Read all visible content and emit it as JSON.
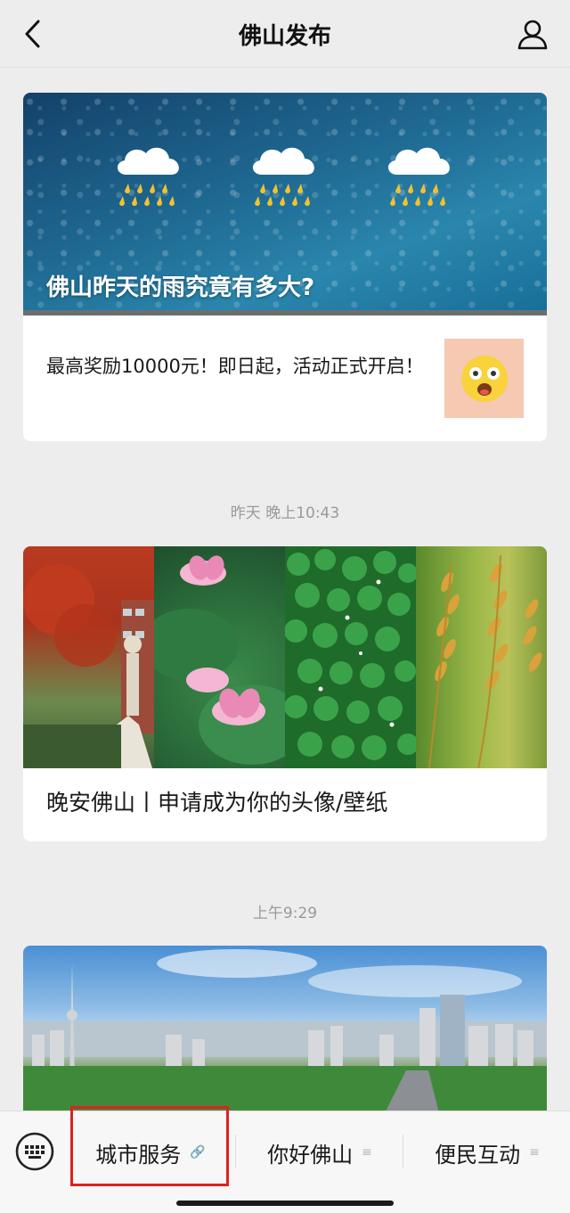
{
  "header": {
    "title": "佛山发布",
    "back_icon": "chevron-left-icon",
    "profile_icon": "person-icon"
  },
  "articles": [
    {
      "image": "rain-clouds-banner",
      "title": "佛山昨天的雨究竟有多大?",
      "sub_article": {
        "text": "最高奖励10000元！即日起，活动正式开启！",
        "thumb": "surprised-emoji-icon"
      }
    },
    {
      "timestamp": "昨天 晚上10:43",
      "images": [
        "red-flower-fountain",
        "pink-lotus",
        "green-lily-pads",
        "golden-rice"
      ],
      "title": "晚安佛山丨申请成为你的头像/壁纸"
    },
    {
      "timestamp": "上午9:29",
      "image": "city-skyline"
    }
  ],
  "bottom_menu": {
    "keyboard_icon": "keyboard-icon",
    "items": [
      {
        "label": "城市服务",
        "suffix_icon": "link-icon",
        "suffix": "🔗"
      },
      {
        "label": "你好佛山",
        "suffix_icon": "menu-lines-icon",
        "suffix": "≡"
      },
      {
        "label": "便民互动",
        "suffix_icon": "menu-lines-icon",
        "suffix": "≡"
      }
    ]
  },
  "colors": {
    "highlight": "#e02020",
    "background": "#ededed"
  }
}
